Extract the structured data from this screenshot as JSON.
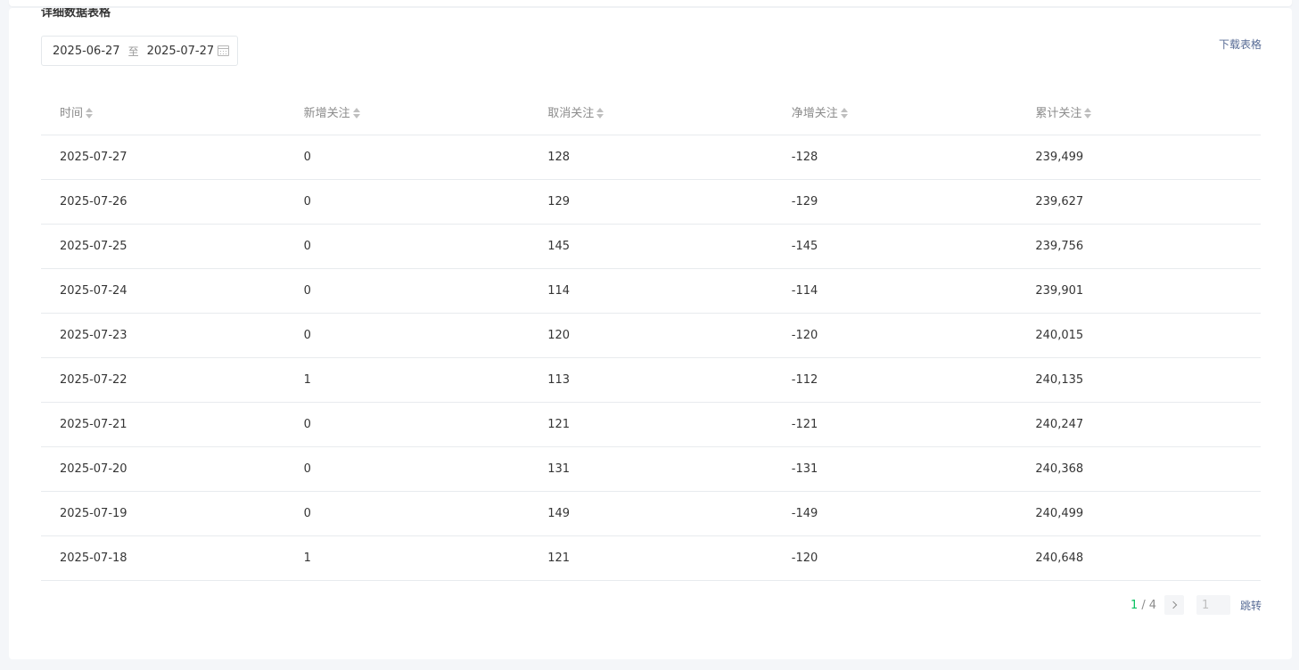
{
  "section": {
    "title": "详细数据表格",
    "download_label": "下载表格"
  },
  "date_range": {
    "start": "2025-06-27",
    "separator": "至",
    "end": "2025-07-27"
  },
  "table": {
    "columns": [
      "时间",
      "新增关注",
      "取消关注",
      "净增关注",
      "累计关注"
    ],
    "rows": [
      [
        "2025-07-27",
        "0",
        "128",
        "-128",
        "239,499"
      ],
      [
        "2025-07-26",
        "0",
        "129",
        "-129",
        "239,627"
      ],
      [
        "2025-07-25",
        "0",
        "145",
        "-145",
        "239,756"
      ],
      [
        "2025-07-24",
        "0",
        "114",
        "-114",
        "239,901"
      ],
      [
        "2025-07-23",
        "0",
        "120",
        "-120",
        "240,015"
      ],
      [
        "2025-07-22",
        "1",
        "113",
        "-112",
        "240,135"
      ],
      [
        "2025-07-21",
        "0",
        "121",
        "-121",
        "240,247"
      ],
      [
        "2025-07-20",
        "0",
        "131",
        "-131",
        "240,368"
      ],
      [
        "2025-07-19",
        "0",
        "149",
        "-149",
        "240,499"
      ],
      [
        "2025-07-18",
        "1",
        "121",
        "-120",
        "240,648"
      ]
    ]
  },
  "pagination": {
    "current": "1",
    "separator": "/",
    "total": "4",
    "jump_input_value": "1",
    "jump_label": "跳转"
  },
  "colors": {
    "accent_green": "#07c160",
    "link_blue": "#576b95"
  }
}
